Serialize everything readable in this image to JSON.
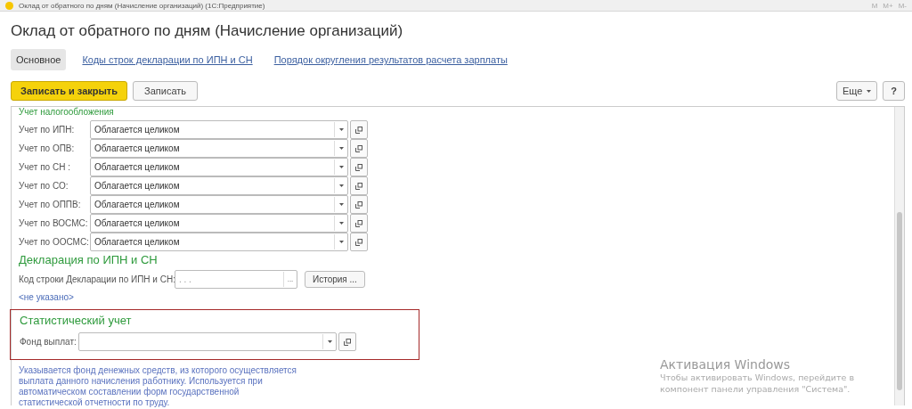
{
  "window": {
    "title": "Оклад от обратного по дням (Начисление организаций)  (1С:Предприятие)",
    "tools": [
      "M",
      "M+",
      "M-"
    ]
  },
  "form_title": "Оклад от обратного по дням (Начисление организаций)",
  "tabs": [
    {
      "label": "Основное",
      "selected": true
    },
    {
      "label": "Коды строк декларации по ИПН и СН",
      "selected": false
    },
    {
      "label": "Порядок округления результатов расчета зарплаты",
      "selected": false
    }
  ],
  "command_bar": {
    "primary": "Записать и закрыть",
    "secondary": "Записать",
    "more": "Еще",
    "help": "?"
  },
  "tax_section": {
    "title": "Учет налогообложения",
    "rows": [
      {
        "label": "Учет по ИПН:",
        "value": "Облагается целиком"
      },
      {
        "label": "Учет по ОПВ:",
        "value": "Облагается целиком"
      },
      {
        "label": "Учет по СН :",
        "value": "Облагается целиком"
      },
      {
        "label": "Учет по СО:",
        "value": "Облагается целиком"
      },
      {
        "label": "Учет по ОППВ:",
        "value": "Облагается целиком"
      },
      {
        "label": "Учет по ВОСМС:",
        "value": "Облагается целиком"
      },
      {
        "label": "Учет по ООСМС:",
        "value": "Облагается целиком"
      }
    ]
  },
  "declaration": {
    "title": "Декларация по ИПН и СН",
    "label": "Код строки Декларации по ИПН и СН:",
    "placeholder": ".    .    .",
    "select": "...",
    "history": "История ...",
    "note": "<не указано>"
  },
  "statistics": {
    "title": "Статистический учет",
    "label": "Фонд выплат:",
    "hint": "Указывается фонд денежных средств, из которого осуществляется выплата данного начисления работнику. Используется при автоматическом составлении форм государственной статистической отчетности по труду."
  },
  "os_notice": {
    "title": "Активация Windows",
    "text": "Чтобы активировать Windows, перейдите в компонент панели управления \"Система\"."
  }
}
